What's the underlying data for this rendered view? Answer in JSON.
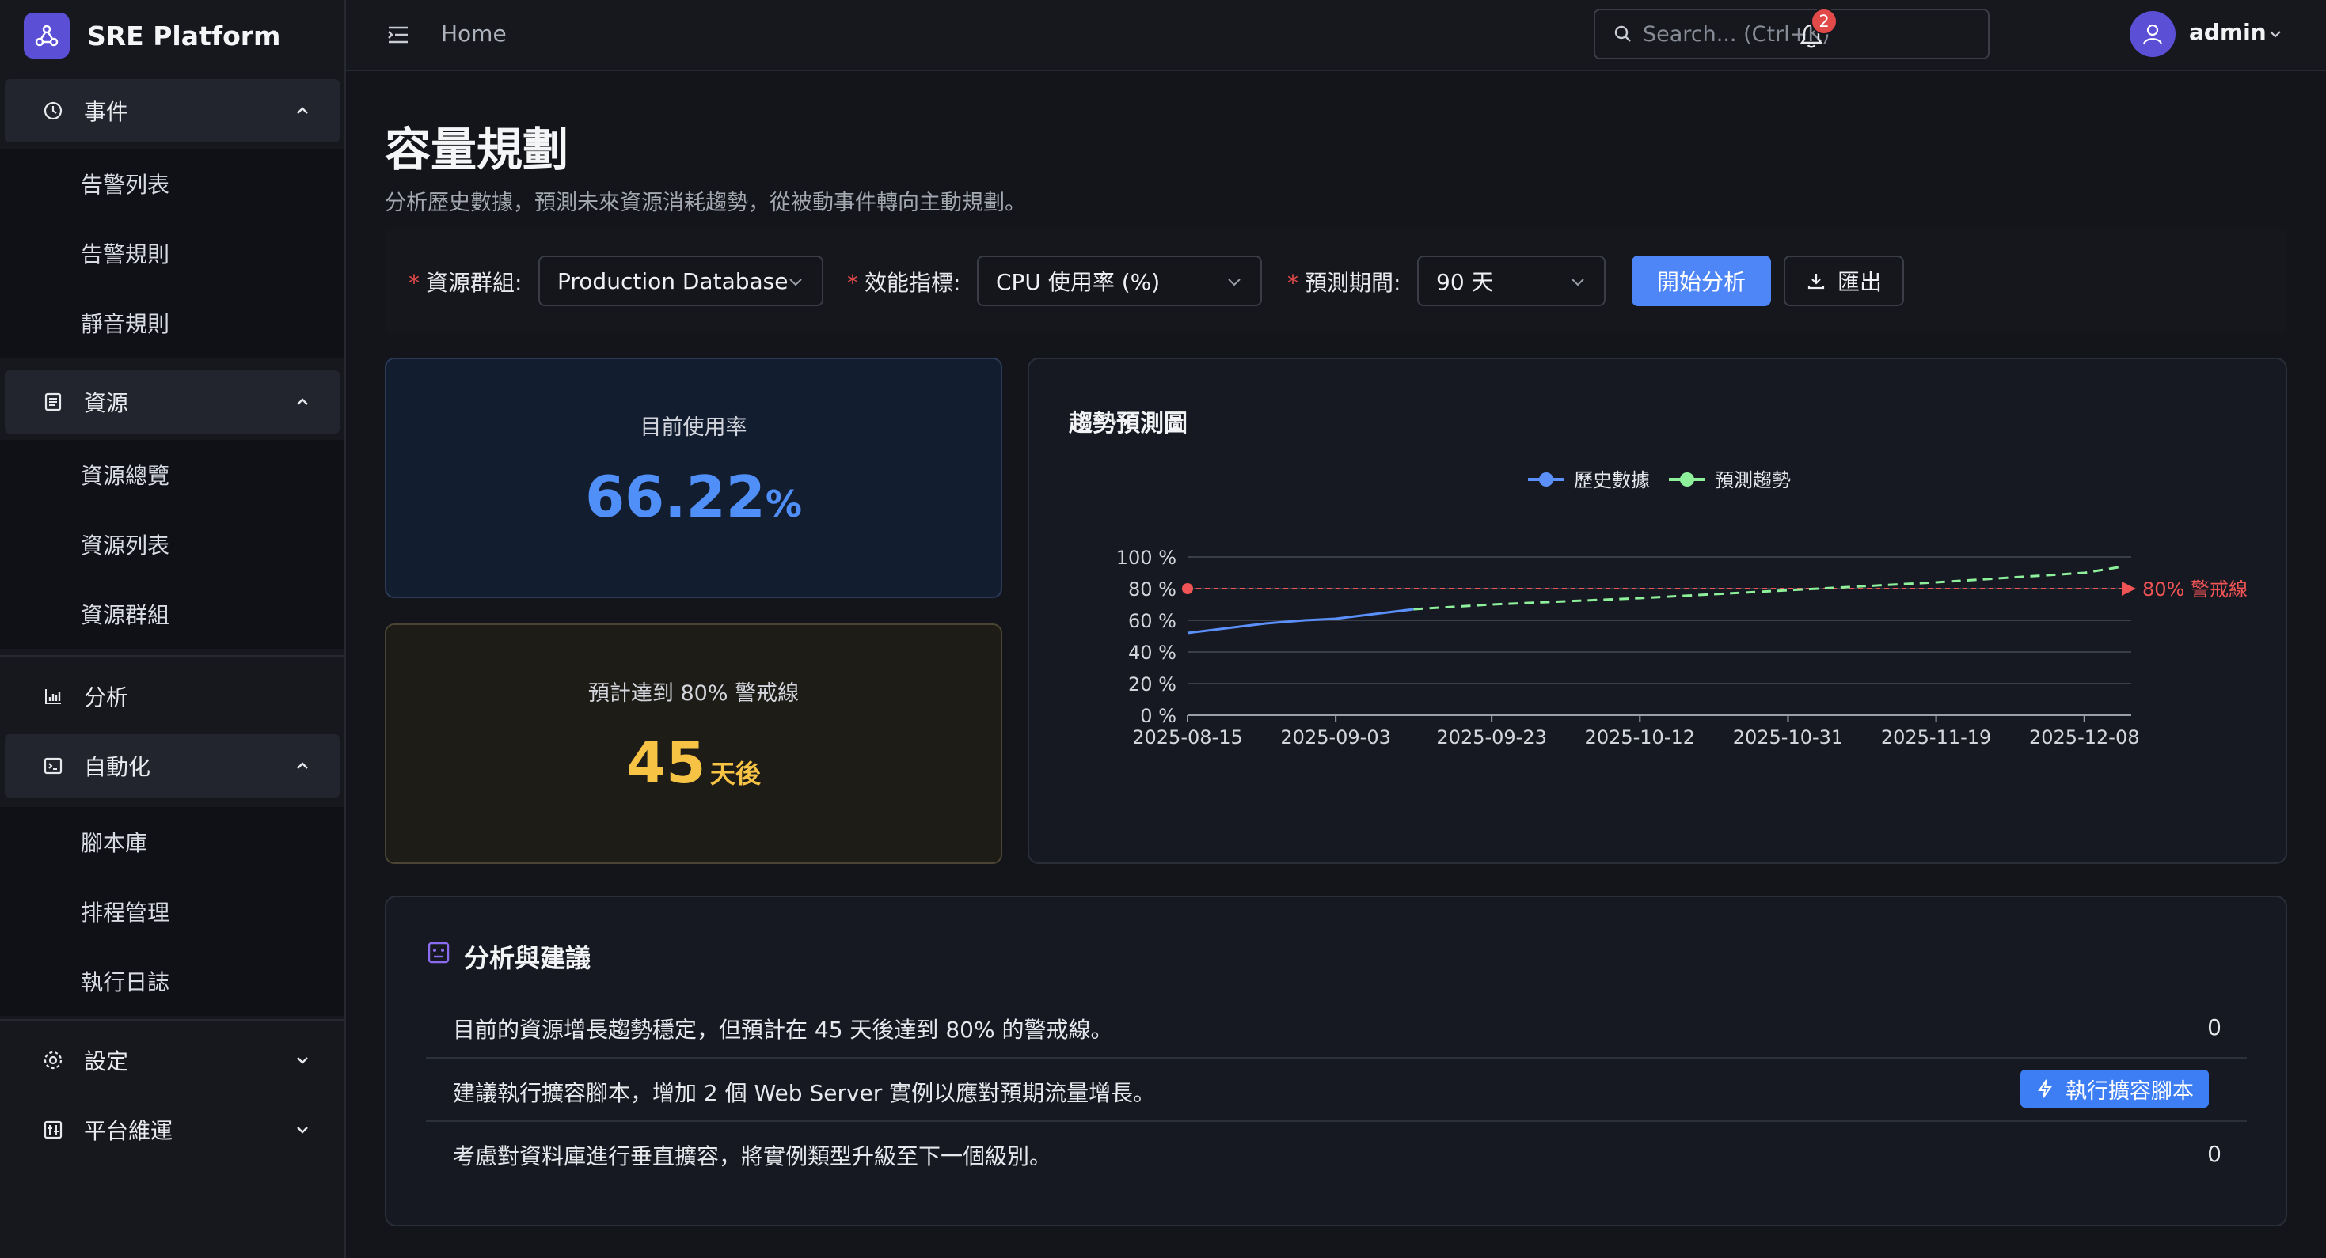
{
  "brand": {
    "name": "SRE Platform"
  },
  "header": {
    "breadcrumb": "Home",
    "search_placeholder": "Search... (Ctrl+K)",
    "notification_count": "2",
    "user": "admin"
  },
  "sidebar": {
    "groups": [
      {
        "label": "事件",
        "icon": "history-icon",
        "expanded": true,
        "items": [
          "告警列表",
          "告警規則",
          "靜音規則"
        ]
      },
      {
        "label": "資源",
        "icon": "database-icon",
        "expanded": true,
        "items": [
          "資源總覽",
          "資源列表",
          "資源群組"
        ]
      },
      {
        "label": "分析",
        "icon": "bar-chart-icon"
      },
      {
        "label": "自動化",
        "icon": "terminal-icon",
        "expanded": true,
        "items": [
          "腳本庫",
          "排程管理",
          "執行日誌"
        ]
      },
      {
        "label": "設定",
        "icon": "gear-icon",
        "expanded": false
      },
      {
        "label": "平台維運",
        "icon": "control-panel-icon",
        "expanded": false
      }
    ]
  },
  "page": {
    "title": "容量規劃",
    "subtitle": "分析歷史數據，預測未來資源消耗趨勢，從被動事件轉向主動規劃。"
  },
  "filters": {
    "resource_group_label": "資源群組:",
    "resource_group_value": "Production Database",
    "metric_label": "效能指標:",
    "metric_value": "CPU 使用率 (%)",
    "period_label": "預測期間:",
    "period_value": "90 天",
    "required_mark": "*",
    "analyze_button": "開始分析",
    "export_button": "匯出"
  },
  "stats": {
    "usage_title": "目前使用率",
    "usage_value": "66.22",
    "usage_unit": "%",
    "days_title": "預計達到 80% 警戒線",
    "days_value": "45",
    "days_unit": "天後"
  },
  "chart_data": {
    "type": "line",
    "title": "趨勢預測圖",
    "series": [
      {
        "name": "歷史數據",
        "color": "#5b8ff9",
        "style": "solid",
        "x": [
          "2025-08-15",
          "2025-08-20",
          "2025-08-25",
          "2025-08-30",
          "2025-09-03",
          "2025-09-08",
          "2025-09-13"
        ],
        "values": [
          52,
          55,
          58,
          60,
          61,
          64,
          67
        ]
      },
      {
        "name": "預測趨勢",
        "color": "#8ef09b",
        "style": "dashed",
        "x": [
          "2025-09-13",
          "2025-09-23",
          "2025-10-12",
          "2025-10-31",
          "2025-11-19",
          "2025-12-08",
          "2025-12-13"
        ],
        "values": [
          67,
          70,
          74,
          79,
          84,
          90,
          94
        ]
      }
    ],
    "x_ticks": [
      "2025-08-15",
      "2025-09-03",
      "2025-09-23",
      "2025-10-12",
      "2025-10-31",
      "2025-11-19",
      "2025-12-08"
    ],
    "y_ticks": [
      "0 %",
      "20 %",
      "40 %",
      "60 %",
      "80 %",
      "100 %"
    ],
    "ylim": [
      0,
      100
    ],
    "threshold": {
      "value": 80,
      "label": "80% 警戒線",
      "color": "#f05454"
    },
    "legend_position": "top-center",
    "grid": true
  },
  "analysis": {
    "title": "分析與建議",
    "rows": [
      {
        "text": "目前的資源增長趨勢穩定，但預計在 45 天後達到 80% 的警戒線。",
        "count": "0"
      },
      {
        "text": "建議執行擴容腳本，增加 2 個 Web Server 實例以應對預期流量增長。",
        "action": "執行擴容腳本"
      },
      {
        "text": "考慮對資料庫進行垂直擴容，將實例類型升級至下一個級別。",
        "count": "0"
      }
    ]
  },
  "colors": {
    "accent": "#4f86f7",
    "usage": "#4f8ff7",
    "days": "#f6c344",
    "danger": "#e24a4a"
  }
}
